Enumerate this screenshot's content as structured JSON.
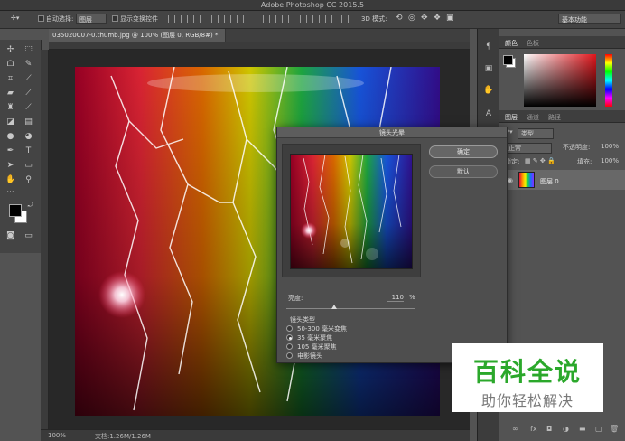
{
  "window": {
    "title": "Adobe Photoshop CC 2015.5"
  },
  "options_bar": {
    "auto_select_label": "自动选择:",
    "auto_select_value": "图层",
    "show_transform_label": "显示变换控件",
    "mode_3d_label": "3D 模式:",
    "workspace": "基本功能"
  },
  "document": {
    "tab_title": "035020C07-0.thumb.jpg @ 100% (图层 0, RGB/8#) *",
    "zoom": "100%",
    "doc_info": "文档:1.26M/1.26M"
  },
  "dialog": {
    "title": "镜头光晕",
    "ok_label": "确定",
    "reset_label": "默认",
    "brightness_label": "亮度:",
    "brightness_value": "110",
    "brightness_unit": "%",
    "brightness_fraction": 0.37,
    "lens_type_label": "镜头类型",
    "lens_options": [
      "50-300 毫米变焦",
      "35 毫米聚焦",
      "105 毫米聚焦",
      "电影镜头"
    ],
    "lens_selected": 1
  },
  "right_panel": {
    "color_tabs": [
      "颜色",
      "色板"
    ],
    "layer_tabs": [
      "图层",
      "通道",
      "路径"
    ],
    "kind_filter": "类型",
    "blend_mode": "正常",
    "opacity_label": "不透明度:",
    "opacity_value": "100%",
    "lock_label": "锁定:",
    "fill_label": "填充:",
    "fill_value": "100%",
    "layer_name": "图层 0"
  },
  "watermark": {
    "line1": "百科全说",
    "line2": "助你轻松解决"
  },
  "colors": {
    "accent_green": "#2ba82b",
    "fg": "#000000",
    "bg": "#ffffff"
  }
}
